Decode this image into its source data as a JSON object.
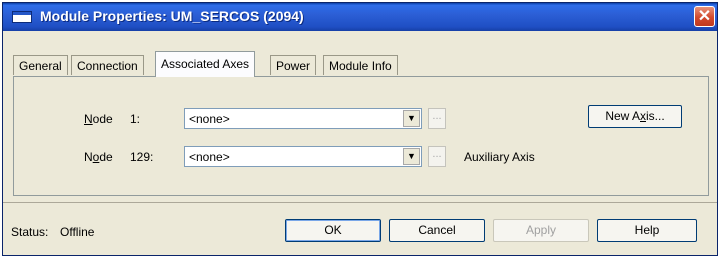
{
  "window": {
    "title": "Module Properties: UM_SERCOS (2094)",
    "close_glyph": "✕"
  },
  "tabs": [
    {
      "label": "General",
      "active": false
    },
    {
      "label": "Connection",
      "active": false
    },
    {
      "label": "Associated Axes",
      "active": true
    },
    {
      "label": "Power",
      "active": false
    },
    {
      "label": "Module Info",
      "active": false
    }
  ],
  "nodes": [
    {
      "label_access": "N",
      "label_rest": "ode",
      "number": "1:",
      "value": "<none>",
      "browse_label": "...",
      "note": ""
    },
    {
      "label_access": "o",
      "label_prefix": "N",
      "label_rest": "de",
      "number": "129:",
      "value": "<none>",
      "browse_label": "...",
      "note": "Auxiliary Axis"
    }
  ],
  "new_axis_button": {
    "label_pre": "New A",
    "label_access": "x",
    "label_post": "is..."
  },
  "status": {
    "label": "Status:",
    "value": "Offline"
  },
  "buttons": {
    "ok": "OK",
    "cancel": "Cancel",
    "apply": "Apply",
    "help": "Help"
  },
  "icons": {
    "window_icon": "window-icon",
    "close_icon": "close-icon",
    "dropdown_icon": "chevron-down-icon"
  },
  "colors": {
    "titlebar": "#2c5fd6",
    "window_bg": "#ece9d8",
    "close_button": "#d2492e"
  }
}
